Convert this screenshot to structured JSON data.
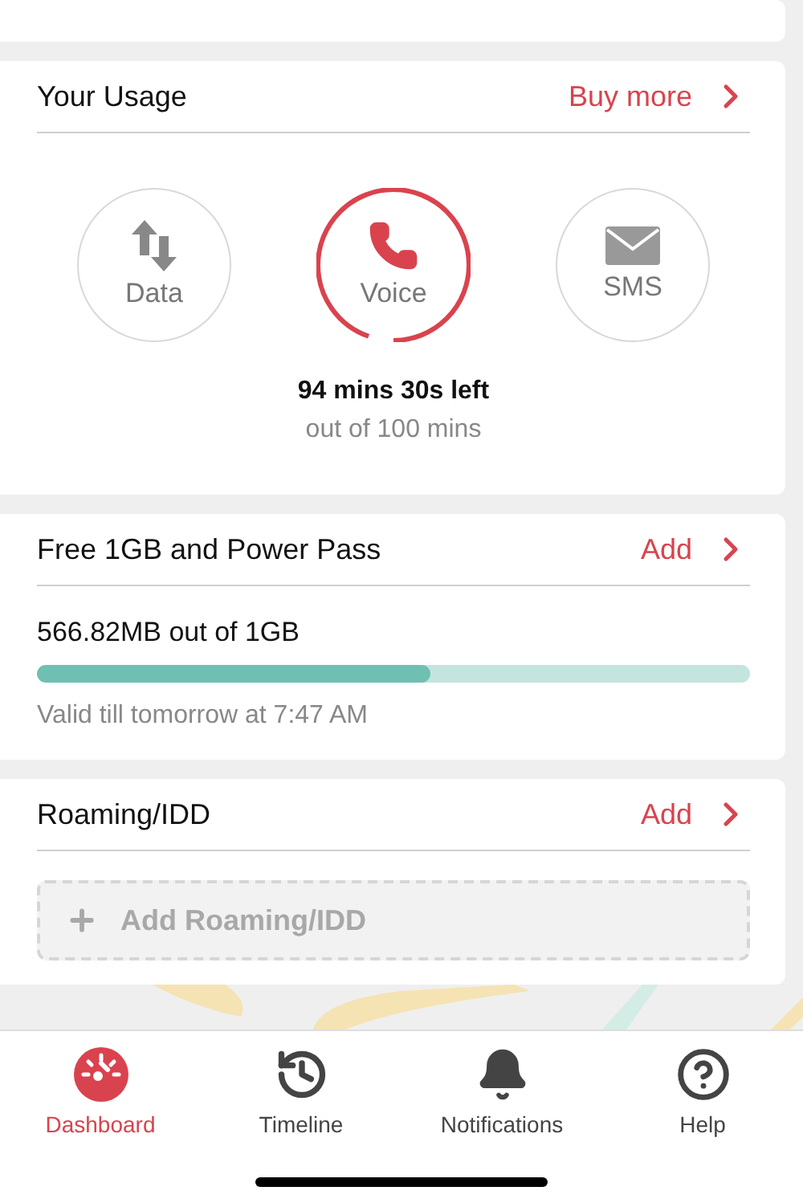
{
  "usage": {
    "title": "Your Usage",
    "action": "Buy more",
    "level": 0.945,
    "remaining": "94 mins 30s left",
    "total": "out of 100 mins",
    "services": [
      {
        "label": "Data",
        "kind": "data",
        "selected": false
      },
      {
        "label": "Voice",
        "kind": "voice",
        "selected": true
      },
      {
        "label": "SMS",
        "kind": "sms",
        "selected": false
      }
    ]
  },
  "pass": {
    "title": "Free 1GB and Power Pass",
    "action": "Add",
    "amount": "566.82MB out of 1GB",
    "level": 0.552,
    "validity": "Valid till tomorrow at 7:47 AM"
  },
  "roaming": {
    "title": "Roaming/IDD",
    "action": "Add",
    "add_button": "Add Roaming/IDD"
  },
  "nav": [
    {
      "label": "Dashboard",
      "kind": "dashboard",
      "selected": true
    },
    {
      "label": "Timeline",
      "kind": "timeline",
      "selected": false
    },
    {
      "label": "Notifications",
      "kind": "notifications",
      "selected": false
    },
    {
      "label": "Help",
      "kind": "help",
      "selected": false
    }
  ]
}
